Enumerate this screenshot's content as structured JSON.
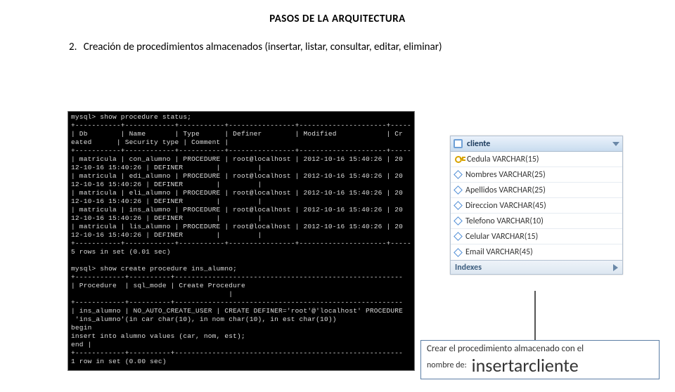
{
  "title": "PASOS DE LA ARQUITECTURA",
  "step": {
    "num": "2.",
    "text": "Creación de procedimientos almacenados (insertar, listar, consultar, editar, eliminar)"
  },
  "console": "mysql> show procedure status;\n+-----------+------------+-----------+----------------+---------------------+-----\n| Db        | Name       | Type      | Definer        | Modified            | Cr\neated      | Security type | Comment |\n+-----------+------------+-----------+----------------+---------------------+-----\n| matricula | con_alumno | PROCEDURE | root@localhost | 2012-10-16 15:40:26 | 20\n12-10-16 15:40:26 | DEFINER        |         |\n| matricula | edi_alumno | PROCEDURE | root@localhost | 2012-10-16 15:40:26 | 20\n12-10-16 15:40:26 | DEFINER        |         |\n| matricula | eli_alumno | PROCEDURE | root@localhost | 2012-10-16 15:40:26 | 20\n12-10-16 15:40:26 | DEFINER        |         |\n| matricula | ins_alumno | PROCEDURE | root@localhost | 2012-10-16 15:40:26 | 20\n12-10-16 15:40:26 | DEFINER        |         |\n| matricula | lis_alumno | PROCEDURE | root@localhost | 2012-10-16 15:40:26 | 20\n12-10-16 15:40:26 | DEFINER        |         |\n+-----------+------------+-----------+----------------+---------------------+-----\n5 rows in set (0.01 sec)\n\nmysql> show create procedure ins_alumno;\n+------------+----------+-------------------------------------------------------\n| Procedure  | sql_mode | Create Procedure\n                                      |\n+------------+----------+-------------------------------------------------------\n| ins_alumno | NO_AUTO_CREATE_USER | CREATE DEFINER='root'@'localhost' PROCEDURE\n 'ins_alumno'(in car char(10), in nom char(10), in est char(10))\nbegin\ninsert into alumno values (car, nom, est);\nend |\n+------------+----------+-------------------------------------------------------\n1 row in set (0.00 sec)",
  "table": {
    "name": "cliente",
    "columns": [
      {
        "pk": true,
        "label": "Cedula VARCHAR(15)"
      },
      {
        "pk": false,
        "label": "Nombres VARCHAR(25)"
      },
      {
        "pk": false,
        "label": "Apellidos VARCHAR(25)"
      },
      {
        "pk": false,
        "label": "Direccion VARCHAR(45)"
      },
      {
        "pk": false,
        "label": "Telefono VARCHAR(10)"
      },
      {
        "pk": false,
        "label": "Celular VARCHAR(15)"
      },
      {
        "pk": false,
        "label": "Email VARCHAR(45)"
      }
    ],
    "indexes_label": "Indexes"
  },
  "note": {
    "line1": "Crear el procedimiento almacenado con el",
    "prefix": "nombre de:",
    "proc_name": "insertarcliente"
  }
}
